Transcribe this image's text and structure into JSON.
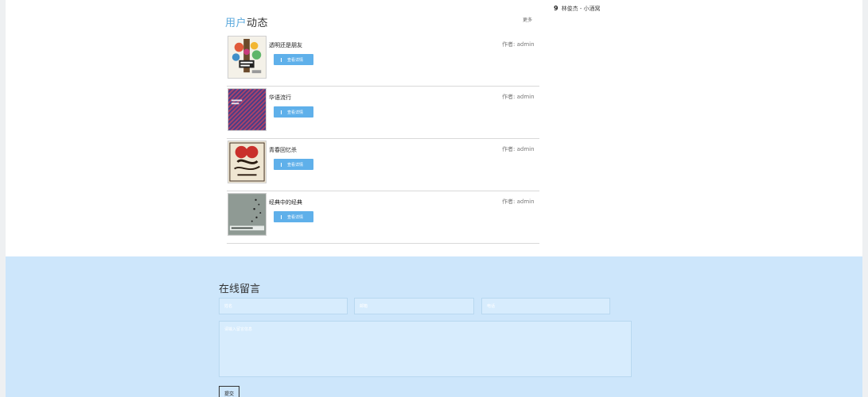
{
  "user_feed": {
    "title_accent": "用户",
    "title_rest": "动态",
    "more_label": "更多",
    "detail_label": "查看详情",
    "items": [
      {
        "title": "透明还是朋友",
        "author": "作者: admin"
      },
      {
        "title": "华语流行",
        "author": "作者: admin"
      },
      {
        "title": "青春回忆杀",
        "author": "作者: admin"
      },
      {
        "title": "经典中的经典",
        "author": "作者: admin"
      }
    ]
  },
  "ranking": {
    "number": "9",
    "text": "林俊杰 - 小酒窝"
  },
  "message": {
    "title": "在线留言",
    "name_placeholder": "姓名",
    "email_placeholder": "邮箱",
    "phone_placeholder": "电话",
    "content_placeholder": "请输入留言信息",
    "submit_label": "提交"
  }
}
